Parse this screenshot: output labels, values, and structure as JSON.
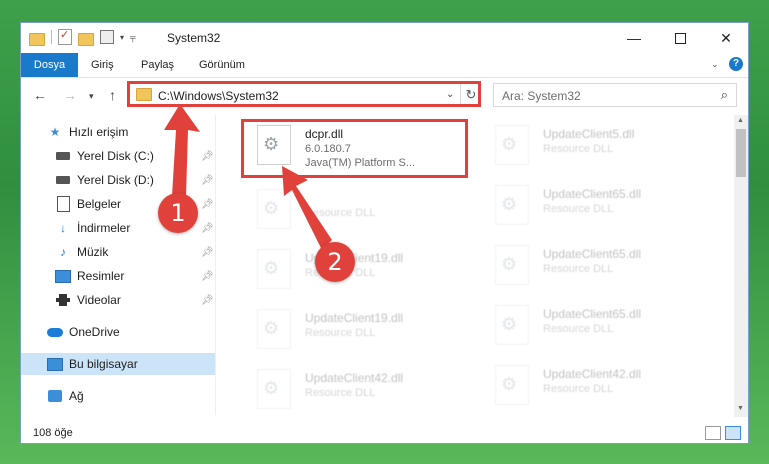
{
  "window": {
    "title": "System32",
    "controls": {
      "minimize": "—",
      "maximize": "",
      "close": "✕"
    }
  },
  "ribbon": {
    "tabs": [
      "Dosya",
      "Giriş",
      "Paylaş",
      "Görünüm"
    ],
    "help": "?"
  },
  "navigation": {
    "back": "←",
    "forward": "→",
    "up": "↑",
    "address": "C:\\Windows\\System32",
    "refresh": "↻",
    "search_placeholder": "Ara: System32",
    "search_icon": "search-icon"
  },
  "sidebar": {
    "items": [
      {
        "label": "Hızlı erişim",
        "icon": "star-icon",
        "pinned": false
      },
      {
        "label": "Yerel Disk (C:)",
        "icon": "drive-icon",
        "pinned": true
      },
      {
        "label": "Yerel Disk (D:)",
        "icon": "drive-icon",
        "pinned": true
      },
      {
        "label": "Belgeler",
        "icon": "document-icon",
        "pinned": true
      },
      {
        "label": "İndirmeler",
        "icon": "download-icon",
        "pinned": true
      },
      {
        "label": "Müzik",
        "icon": "music-icon",
        "pinned": true
      },
      {
        "label": "Resimler",
        "icon": "pictures-icon",
        "pinned": true
      },
      {
        "label": "Videolar",
        "icon": "video-icon",
        "pinned": true
      },
      {
        "label": "OneDrive",
        "icon": "cloud-icon",
        "pinned": false
      },
      {
        "label": "Bu bilgisayar",
        "icon": "computer-icon",
        "pinned": false,
        "selected": true
      },
      {
        "label": "Ağ",
        "icon": "network-icon",
        "pinned": false
      }
    ]
  },
  "files": {
    "highlighted": {
      "name": "dcpr.dll",
      "version": "6.0.180.7",
      "description": "Java(TM) Platform S..."
    },
    "col1": [
      {
        "name": "",
        "type": "Resource DLL"
      },
      {
        "name": "UpdateClient19.dll",
        "type": "Resource DLL"
      },
      {
        "name": "UpdateClient19.dll",
        "type": "Resource DLL"
      },
      {
        "name": "UpdateClient42.dll",
        "type": "Resource DLL"
      }
    ],
    "col2": [
      {
        "name": "UpdateClient5.dll",
        "type": "Resource DLL"
      },
      {
        "name": "UpdateClient65.dll",
        "type": "Resource DLL"
      },
      {
        "name": "UpdateClient65.dll",
        "type": "Resource DLL"
      },
      {
        "name": "UpdateClient65.dll",
        "type": "Resource DLL"
      },
      {
        "name": "UpdateClient42.dll",
        "type": "Resource DLL"
      }
    ]
  },
  "status": {
    "count": "108 öğe"
  },
  "annotations": {
    "step1": "1",
    "step2": "2",
    "color": "#e0413a"
  }
}
